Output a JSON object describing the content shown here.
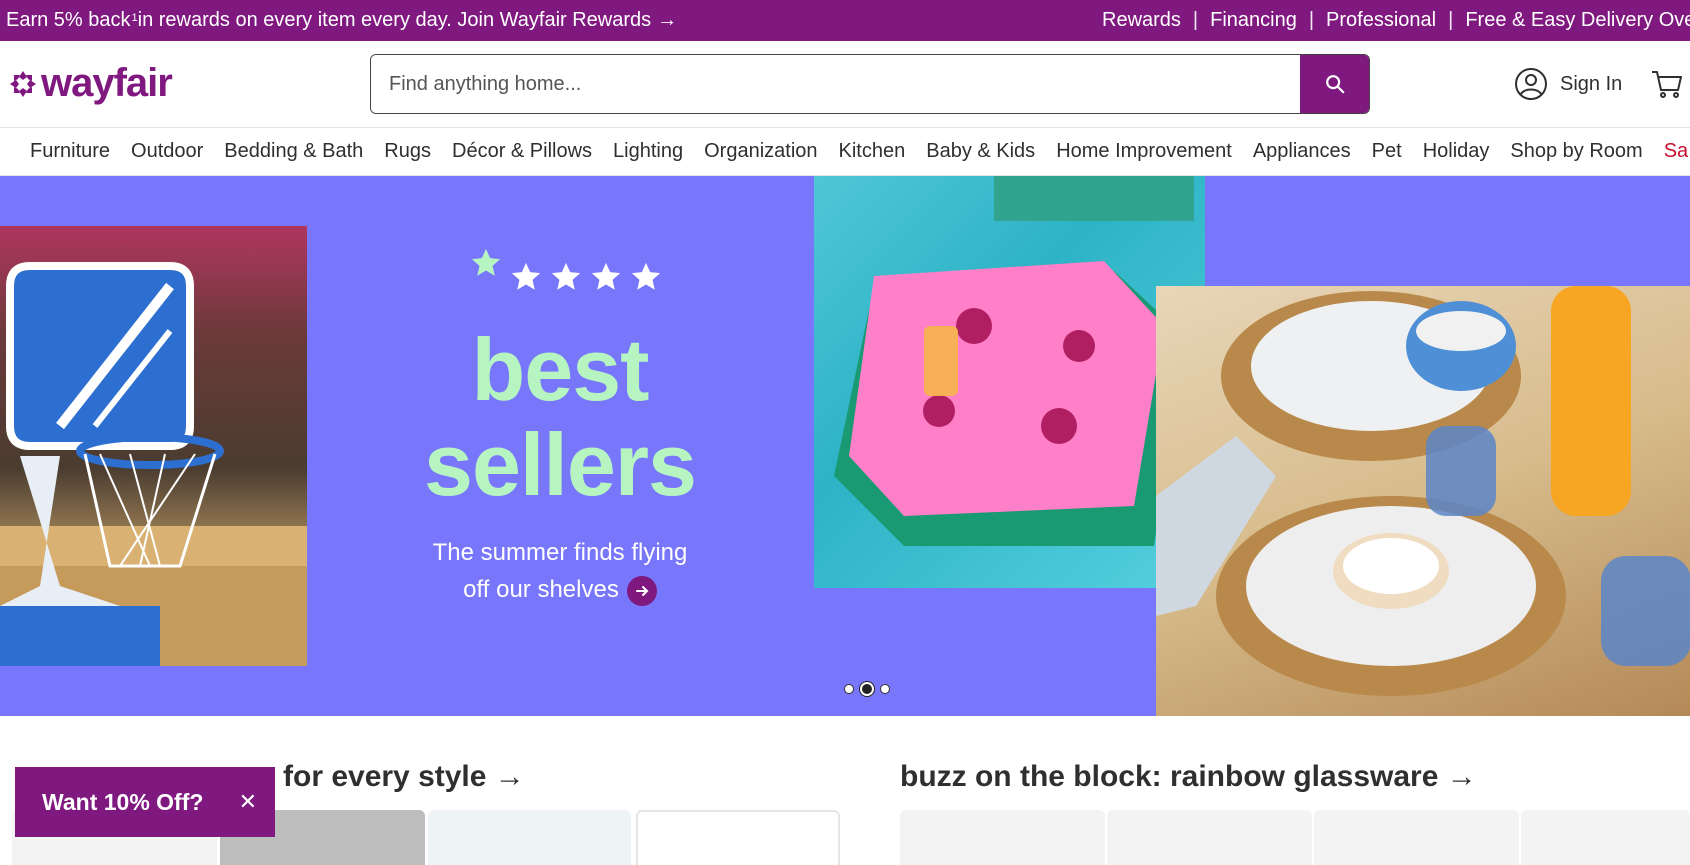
{
  "promo": {
    "left_text": "Earn 5% back",
    "left_sup": "1",
    "left_text_2": " in rewards on every item every day. Join Wayfair Rewards",
    "arrow": "→",
    "links": [
      "Rewards",
      "Financing",
      "Professional",
      "Free & Easy Delivery Over"
    ]
  },
  "header": {
    "logo_text": "wayfair",
    "search_placeholder": "Find anything home...",
    "signin_label": "Sign In"
  },
  "nav": {
    "items": [
      "Furniture",
      "Outdoor",
      "Bedding & Bath",
      "Rugs",
      "Décor & Pillows",
      "Lighting",
      "Organization",
      "Kitchen",
      "Baby & Kids",
      "Home Improvement",
      "Appliances",
      "Pet",
      "Holiday",
      "Shop by Room",
      "Sa"
    ]
  },
  "hero": {
    "title_line1": "best",
    "title_line2": "sellers",
    "subtitle_line1": "The summer finds flying",
    "subtitle_line2": "off our shelves",
    "slide_count": 3,
    "active_slide": 2,
    "colors": {
      "background": "#7876fa",
      "title": "#b6f5c2"
    }
  },
  "sections": {
    "left_title": "for every style",
    "right_title": "buzz on the block: rainbow glassware",
    "arrow": "→"
  },
  "popup": {
    "label": "Want 10% Off?",
    "close": "✕"
  },
  "colors": {
    "brand": "#7f187f",
    "sale": "#c8102e"
  }
}
